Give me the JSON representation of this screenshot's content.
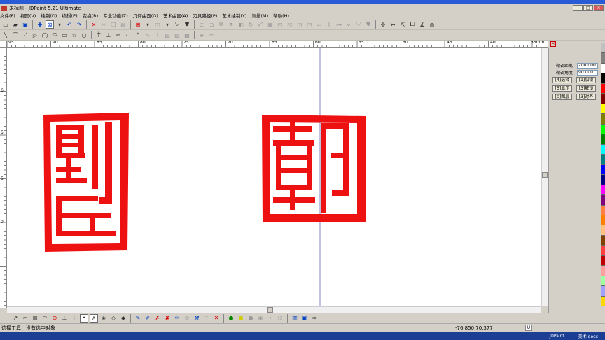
{
  "window": {
    "title": "未标题 - JDPaint 5.21 Ultimate",
    "controls": [
      "_",
      "□",
      "×"
    ]
  },
  "menu": [
    "文件(F)",
    "视图(V)",
    "绘制(D)",
    "编辑(E)",
    "变换(R)",
    "专业功能(Z)",
    "几何曲面(G)",
    "艺术曲面(A)",
    "刀具路径(P)",
    "艺术绘制(Y)",
    "测量(M)",
    "帮助(H)"
  ],
  "ruler": {
    "h_ticks": [
      "95",
      "90",
      "85",
      "80",
      "75",
      "70",
      "65",
      "60",
      "55",
      "50",
      "45",
      "40",
      "35mm"
    ],
    "v_ticks": [
      "6",
      "5",
      "5",
      "0"
    ]
  },
  "panel": {
    "fields": [
      {
        "label": "微调距离",
        "value": "200.000"
      },
      {
        "label": "微调角度",
        "value": "90.000"
      }
    ],
    "buttons": [
      "[4]选择",
      "[1]加锁",
      "[5]显示",
      "[3]解锁",
      "[0]图层",
      "[3]对齐"
    ]
  },
  "status": {
    "text": "选择工具：没有选中对象",
    "coords": "-76.850  70.377",
    "unit": "U"
  },
  "taskbar": [
    "JDPaint",
    "美术.docx"
  ],
  "colors": {
    "seal_red": "#ee1111",
    "palette": [
      "#c0c0c0",
      "#808080",
      "#ffffff",
      "#000000",
      "#ff0000",
      "#800000",
      "#ffff00",
      "#808000",
      "#00ff00",
      "#008000",
      "#00ffff",
      "#008080",
      "#0000ff",
      "#000080",
      "#ff00ff",
      "#800080",
      "#ff8040",
      "#ff8000",
      "#ffc080",
      "#804000",
      "#ff4040",
      "#c00000",
      "#ffa0a0",
      "#a0ffa0",
      "#a0a0ff",
      "#ffd700"
    ]
  }
}
